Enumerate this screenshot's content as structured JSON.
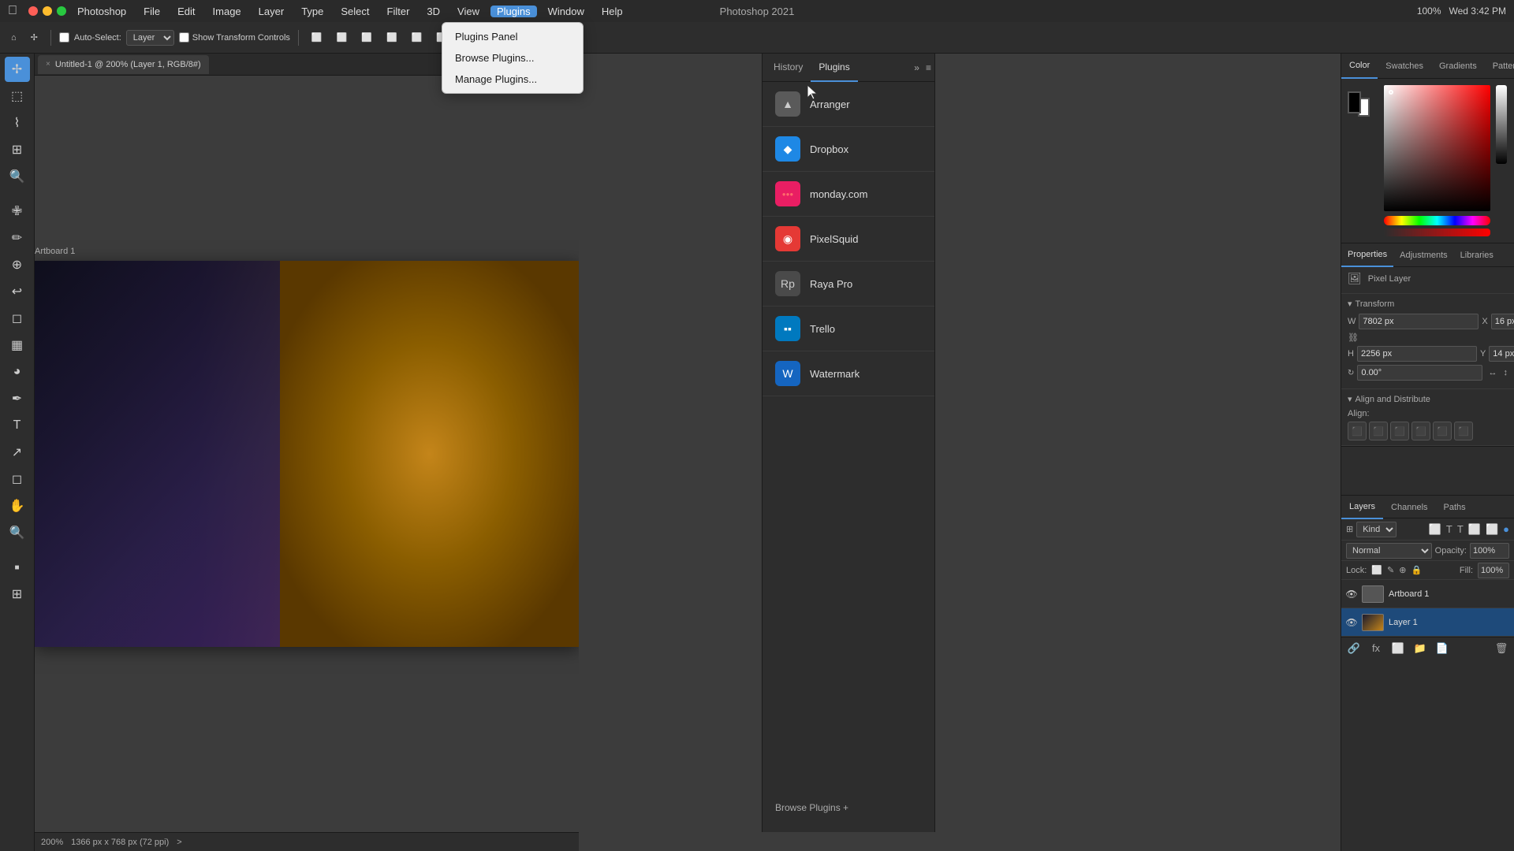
{
  "titlebar": {
    "app_name": "Photoshop",
    "title": "Photoshop 2021",
    "time": "Wed 3:42 PM",
    "battery": "100%",
    "menus": [
      "Apple",
      "Photoshop",
      "File",
      "Edit",
      "Image",
      "Layer",
      "Type",
      "Select",
      "Filter",
      "3D",
      "View",
      "Plugins",
      "Window",
      "Help"
    ]
  },
  "toolbar": {
    "auto_select_label": "Auto-Select:",
    "layer_select": "Layer",
    "show_transform": "Show Transform Controls"
  },
  "document_tab": {
    "title": "Untitled-1 @ 200% (Layer 1, RGB/8#)",
    "close": "×"
  },
  "artboard": {
    "label": "Artboard 1"
  },
  "status_bar": {
    "zoom": "200%",
    "dimensions": "1366 px x 768 px (72 ppi)",
    "arrow": ">"
  },
  "plugins_panel": {
    "tabs": [
      "History",
      "Plugins"
    ],
    "active_tab": "Plugins",
    "plugins": [
      {
        "name": "Arranger",
        "icon": "▲",
        "icon_bg": "#444"
      },
      {
        "name": "Dropbox",
        "icon": "📦",
        "icon_bg": "#1e88e5"
      },
      {
        "name": "monday.com",
        "icon": "⬛",
        "icon_bg": "#e91e63"
      },
      {
        "name": "PixelSquid",
        "icon": "🎯",
        "icon_bg": "#e53935"
      },
      {
        "name": "Raya Pro",
        "icon": "Rp",
        "icon_bg": "#555"
      },
      {
        "name": "Trello",
        "icon": "📋",
        "icon_bg": "#0079bf"
      },
      {
        "name": "Watermark",
        "icon": "W",
        "icon_bg": "#1976d2"
      }
    ],
    "browse_plugins": "Browse Plugins +"
  },
  "plugins_menu": {
    "items": [
      "Plugins Panel",
      "Browse Plugins...",
      "Manage Plugins..."
    ]
  },
  "color_panel": {
    "tabs": [
      "Color",
      "Swatches",
      "Gradients",
      "Patterns"
    ],
    "active_tab": "Color"
  },
  "properties_panel": {
    "tabs": [
      "Properties",
      "Adjustments",
      "Libraries"
    ],
    "active_tab": "Properties",
    "pixel_layer_label": "Pixel Layer",
    "transform_title": "Transform",
    "w_label": "W",
    "h_label": "H",
    "x_label": "X",
    "y_label": "Y",
    "w_value": "7802 px",
    "h_value": "2256 px",
    "x_value": "16 px",
    "y_value": "14 px",
    "rotation_value": "0.00°",
    "align_distribute_title": "Align and Distribute",
    "align_label": "Align:"
  },
  "layers_panel": {
    "tabs": [
      "Layers",
      "Channels",
      "Paths"
    ],
    "active_tab": "Layers",
    "filter_label": "Kind",
    "blend_mode": "Normal",
    "opacity_label": "Opacity:",
    "opacity_value": "100%",
    "fill_label": "Fill:",
    "fill_value": "100%",
    "lock_label": "Lock:",
    "layers": [
      {
        "name": "Artboard 1",
        "type": "artboard",
        "visible": true,
        "expanded": true
      },
      {
        "name": "Layer 1",
        "type": "pixel",
        "visible": true,
        "active": true
      }
    ]
  }
}
